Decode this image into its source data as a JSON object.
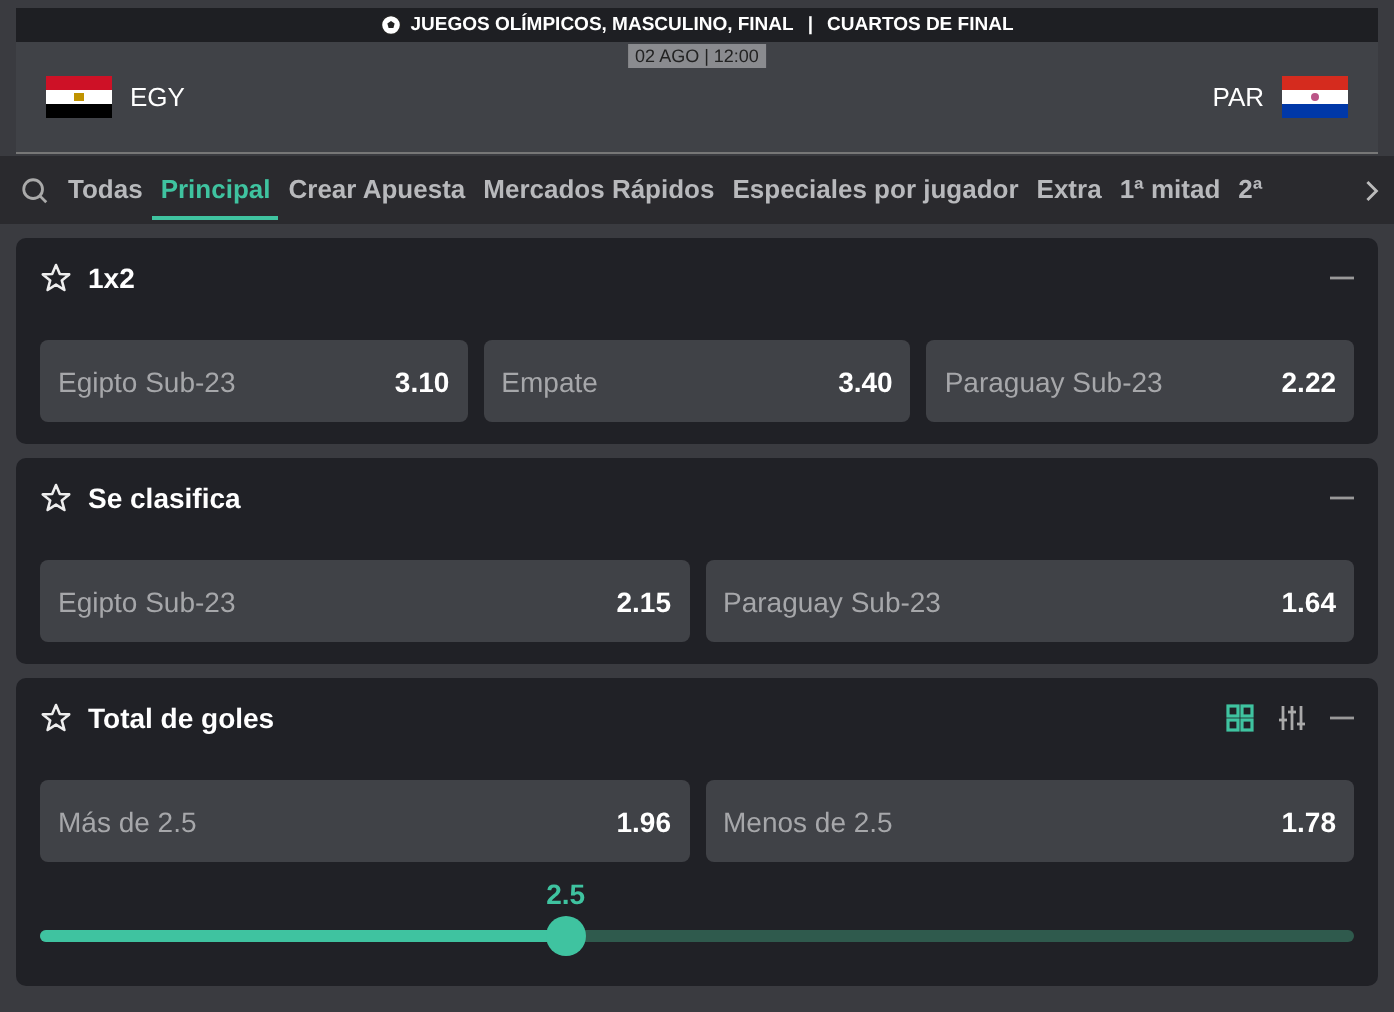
{
  "event": {
    "competition": "JUEGOS OLÍMPICOS, MASCULINO, FINAL",
    "separator": "|",
    "stage": "CUARTOS  DE  FINAL",
    "datetime": "02 AGO | 12:00",
    "home": "EGY",
    "away": "PAR"
  },
  "tabs": [
    {
      "label": "Todas",
      "selected": false
    },
    {
      "label": "Principal",
      "selected": true
    },
    {
      "label": "Crear Apuesta",
      "selected": false
    },
    {
      "label": "Mercados Rápidos",
      "selected": false
    },
    {
      "label": "Especiales por jugador",
      "selected": false
    },
    {
      "label": "Extra",
      "selected": false
    },
    {
      "label": "1ª mitad",
      "selected": false
    },
    {
      "label": "2ª",
      "selected": false
    }
  ],
  "markets": [
    {
      "title": "1x2",
      "expanded": true,
      "tools": false,
      "selections": [
        {
          "name": "Egipto Sub-23",
          "odds": "3.10"
        },
        {
          "name": "Empate",
          "odds": "3.40"
        },
        {
          "name": "Paraguay Sub-23",
          "odds": "2.22"
        }
      ]
    },
    {
      "title": "Se clasifica",
      "expanded": true,
      "tools": false,
      "selections": [
        {
          "name": "Egipto Sub-23",
          "odds": "2.15"
        },
        {
          "name": "Paraguay Sub-23",
          "odds": "1.64"
        }
      ]
    },
    {
      "title": "Total de goles",
      "expanded": true,
      "tools": true,
      "selections": [
        {
          "name": "Más de 2.5",
          "odds": "1.96"
        },
        {
          "name": "Menos de 2.5",
          "odds": "1.78"
        }
      ],
      "slider": {
        "reading": "2.5",
        "level": 0.4
      }
    }
  ]
}
